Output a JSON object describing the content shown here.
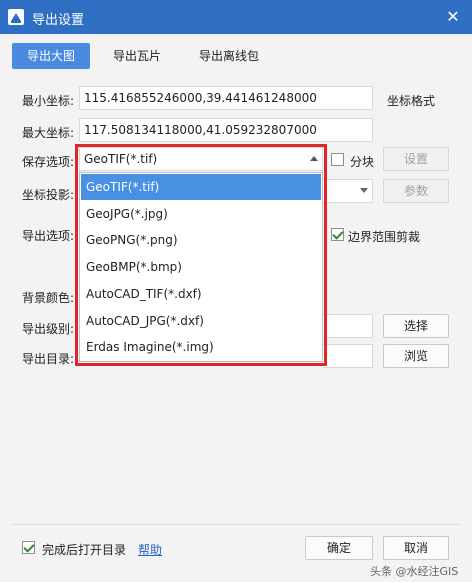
{
  "window": {
    "title": "导出设置",
    "close_glyph": "✕"
  },
  "tabs": [
    {
      "label": "导出大图",
      "active": true
    },
    {
      "label": "导出瓦片",
      "active": false
    },
    {
      "label": "导出离线包",
      "active": false
    }
  ],
  "form": {
    "min_coord_label": "最小坐标:",
    "min_coord_value": "115.416855246000,39.441461248000",
    "coord_format_label": "坐标格式",
    "max_coord_label": "最大坐标:",
    "max_coord_value": "117.508134118000,41.059232807000",
    "save_option_label": "保存选项:",
    "save_option_value": "GeoTIF(*.tif)",
    "block_label": "分块",
    "settings_button": "设置",
    "projection_label": "坐标投影:",
    "params_button": "参数",
    "export_option_label": "导出选项:",
    "border_clip_label": "边界范围剪裁",
    "bg_color_label": "背景颜色:",
    "export_level_label": "导出级别:",
    "select_button": "选择",
    "export_dir_label": "导出目录:",
    "browse_button": "浏览"
  },
  "dropdown": {
    "items": [
      {
        "label": "GeoTIF(*.tif)",
        "selected": true
      },
      {
        "label": "GeoJPG(*.jpg)",
        "selected": false
      },
      {
        "label": "GeoPNG(*.png)",
        "selected": false
      },
      {
        "label": "GeoBMP(*.bmp)",
        "selected": false
      },
      {
        "label": "AutoCAD_TIF(*.dxf)",
        "selected": false
      },
      {
        "label": "AutoCAD_JPG(*.dxf)",
        "selected": false
      },
      {
        "label": "Erdas Imagine(*.img)",
        "selected": false
      }
    ]
  },
  "footer": {
    "open_dir_label": "完成后打开目录",
    "help_link": "帮助",
    "ok_button": "确定",
    "cancel_button": "取消",
    "watermark": "头条 @水经注GIS"
  },
  "colors": {
    "titlebar": "#2f6fc3",
    "accent": "#4a8be0",
    "highlight": "#e0262b"
  }
}
